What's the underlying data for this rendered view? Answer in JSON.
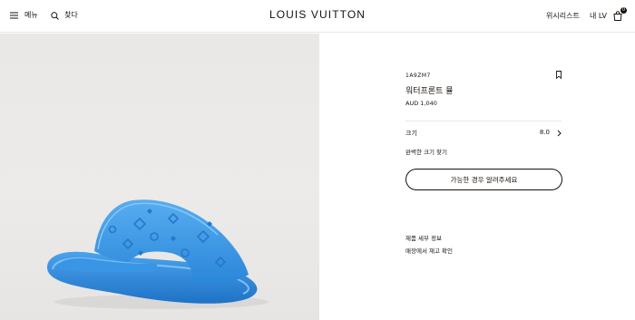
{
  "header": {
    "menu_label": "메뉴",
    "search_label": "찾다",
    "logo_text": "LOUIS VUITTON",
    "wishlist_label": "위시리스트",
    "mylv_label": "내 LV",
    "bag_count": "0"
  },
  "product": {
    "sku": "1A9ZM7",
    "title": "워터프론트 뮬",
    "price": "AUD 1,040",
    "size_label": "크기",
    "size_value": "8.0",
    "size_guide_label": "완벽한 크기 찾기",
    "notify_button_label": "가능한 경우 알려주세요",
    "details_label": "제품 세부 정보",
    "store_stock_label": "매장에서 재고 확인"
  },
  "colors": {
    "text": "#19110b",
    "product_blue": "#3d9be9",
    "gallery_bg": "#eae9e7"
  }
}
